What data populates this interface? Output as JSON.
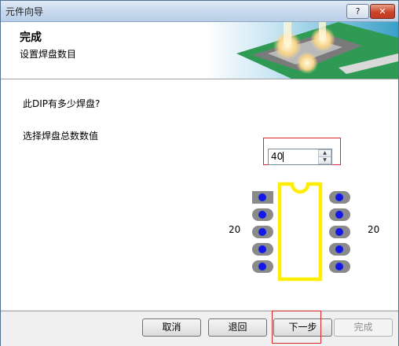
{
  "window": {
    "title": "元件向导",
    "help_label": "?",
    "close_label": "✕"
  },
  "header": {
    "title": "完成",
    "subtitle": "设置焊盘数目"
  },
  "main": {
    "question": "此DIP有多少焊盘?",
    "count_label": "选择焊盘总数数值",
    "pad_count_value": "40",
    "left_count": "20",
    "right_count": "20"
  },
  "buttons": {
    "cancel": "取消",
    "back": "退回",
    "next": "下一步",
    "finish": "完成"
  },
  "colors": {
    "pad": "#8a8a8a",
    "pad_hole": "#1218e8",
    "outline": "#ffee00",
    "highlight": "#d8262b"
  }
}
